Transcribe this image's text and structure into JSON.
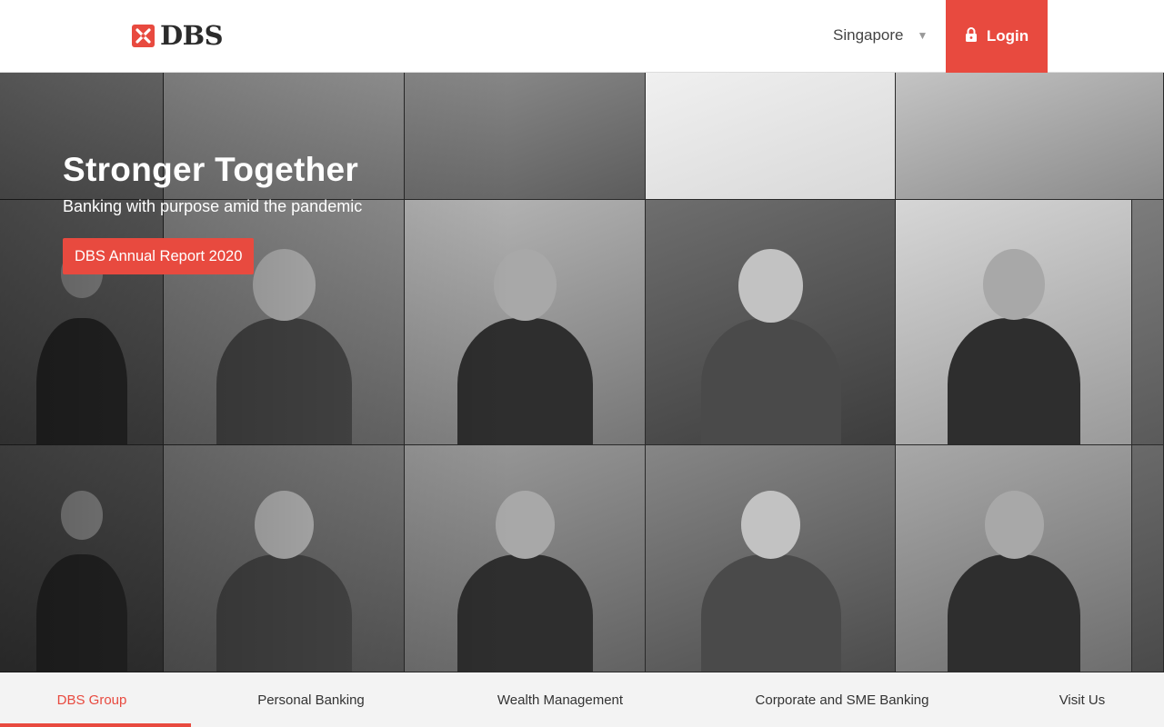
{
  "header": {
    "logo_text": "DBS",
    "country": "Singapore",
    "login_label": "Login"
  },
  "hero": {
    "title": "Stronger Together",
    "subtitle": "Banking with purpose amid the pandemic",
    "cta_label": "DBS Annual Report 2020"
  },
  "bottom_nav": [
    {
      "label": "DBS Group",
      "active": true
    },
    {
      "label": "Personal Banking",
      "active": false
    },
    {
      "label": "Wealth Management",
      "active": false
    },
    {
      "label": "Corporate and SME Banking",
      "active": false
    },
    {
      "label": "Visit Us",
      "active": false
    }
  ],
  "colors": {
    "brand_red": "#e84a3f",
    "nav_background": "#f3f3f3"
  },
  "icons": {
    "logo_mark": "dbs-logo-mark",
    "country_caret": "caret-down-icon",
    "login_icon": "lock-icon"
  }
}
